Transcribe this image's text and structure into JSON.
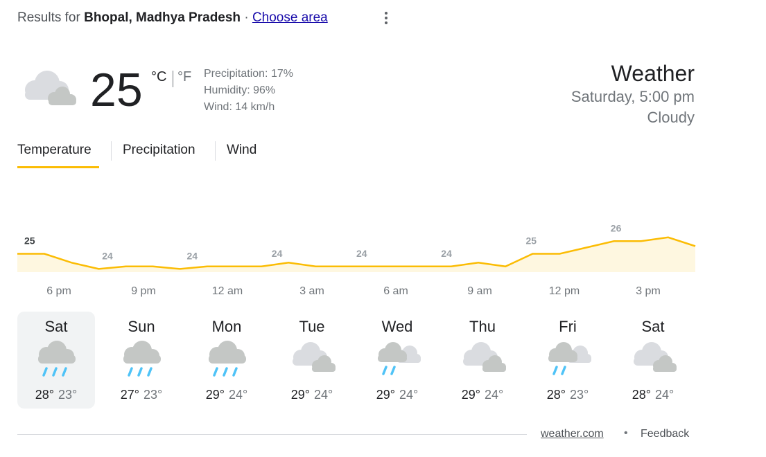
{
  "header": {
    "results_prefix": "Results for",
    "location": "Bhopal, Madhya Pradesh",
    "separator": "·",
    "choose_area": "Choose area"
  },
  "current": {
    "temperature": "25",
    "unit_c": "°C",
    "unit_f": "°F",
    "precipitation": "Precipitation: 17%",
    "humidity": "Humidity: 96%",
    "wind": "Wind: 14 km/h",
    "icon": "cloudy-icon",
    "title": "Weather",
    "datetime": "Saturday, 5:00 pm",
    "condition": "Cloudy"
  },
  "tabs": [
    {
      "label": "Temperature",
      "active": true
    },
    {
      "label": "Precipitation",
      "active": false
    },
    {
      "label": "Wind",
      "active": false
    }
  ],
  "chart_data": {
    "type": "area",
    "x": [
      "5 pm",
      "6 pm",
      "7 pm",
      "8 pm",
      "9 pm",
      "10 pm",
      "11 pm",
      "12 am",
      "1 am",
      "2 am",
      "3 am",
      "4 am",
      "5 am",
      "6 am",
      "7 am",
      "8 am",
      "9 am",
      "10 am",
      "11 am",
      "12 pm",
      "1 pm",
      "2 pm",
      "3 pm",
      "4 pm",
      "5 pm"
    ],
    "values": [
      25,
      25,
      24.3,
      23.8,
      24,
      24,
      23.8,
      24,
      24,
      24,
      24.3,
      24,
      24,
      24,
      24,
      24,
      24,
      24.3,
      24,
      25,
      25,
      25.5,
      26,
      26,
      26.3,
      25.6
    ],
    "point_labels": [
      {
        "index": 0,
        "value": "25"
      },
      {
        "index": 3,
        "value": "24"
      },
      {
        "index": 6,
        "value": "24"
      },
      {
        "index": 9,
        "value": "24"
      },
      {
        "index": 12,
        "value": "24"
      },
      {
        "index": 15,
        "value": "24"
      },
      {
        "index": 18,
        "value": "25"
      },
      {
        "index": 21,
        "value": "26"
      }
    ],
    "time_labels": [
      "6 pm",
      "9 pm",
      "12 am",
      "3 am",
      "6 am",
      "9 am",
      "12 pm",
      "3 pm"
    ],
    "line_color": "#fbbc04",
    "fill_color": "#fef7e0",
    "highlight_label_color": "#3c4043",
    "label_color": "#9aa0a6",
    "ylim": [
      23,
      27
    ]
  },
  "forecast": [
    {
      "day": "Sat",
      "high": "28°",
      "low": "23°",
      "icon": "rain-icon",
      "selected": true
    },
    {
      "day": "Sun",
      "high": "27°",
      "low": "23°",
      "icon": "rain-icon",
      "selected": false
    },
    {
      "day": "Mon",
      "high": "29°",
      "low": "24°",
      "icon": "rain-icon",
      "selected": false
    },
    {
      "day": "Tue",
      "high": "29°",
      "low": "24°",
      "icon": "cloudy-icon",
      "selected": false
    },
    {
      "day": "Wed",
      "high": "29°",
      "low": "24°",
      "icon": "showers-icon",
      "selected": false
    },
    {
      "day": "Thu",
      "high": "29°",
      "low": "24°",
      "icon": "cloudy-icon",
      "selected": false
    },
    {
      "day": "Fri",
      "high": "28°",
      "low": "23°",
      "icon": "showers-icon",
      "selected": false
    },
    {
      "day": "Sat",
      "high": "28°",
      "low": "24°",
      "icon": "cloudy-icon",
      "selected": false
    }
  ],
  "footer": {
    "source": "weather.com",
    "dot": "•",
    "feedback": "Feedback"
  }
}
